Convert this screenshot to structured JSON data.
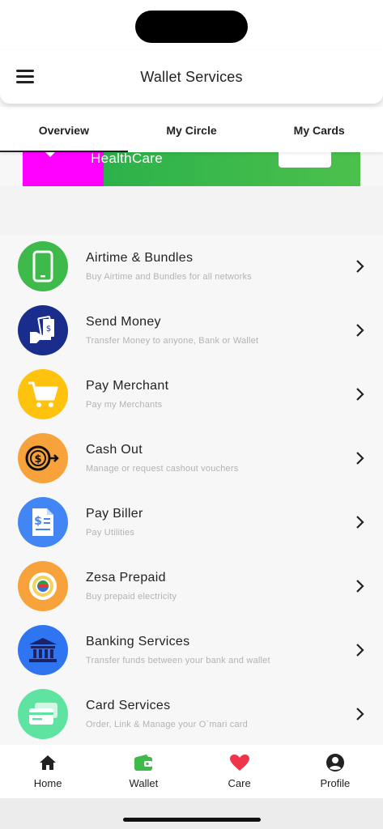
{
  "header": {
    "title": "Wallet Services"
  },
  "tabs": [
    {
      "label": "Overview",
      "active": true
    },
    {
      "label": "My Circle",
      "active": false
    },
    {
      "label": "My Cards",
      "active": false
    }
  ],
  "banner": {
    "text": "HealthCare",
    "colors": {
      "left": "#ff00ff",
      "right": "#3cb84a"
    }
  },
  "services": [
    {
      "title": "Airtime & Bundles",
      "subtitle": "Buy Airtime and Bundles for all networks",
      "icon": "phone-icon",
      "color": "#3dba4a"
    },
    {
      "title": "Send Money",
      "subtitle": "Transfer Money to anyone, Bank or Wallet",
      "icon": "money-hand-icon",
      "color": "#1a2d8c"
    },
    {
      "title": "Pay Merchant",
      "subtitle": "Pay my Merchants",
      "icon": "shopping-cart-icon",
      "color": "#ffc20e"
    },
    {
      "title": "Cash Out",
      "subtitle": "Manage or request cashout vouchers",
      "icon": "dollar-arrow-icon",
      "color": "#f7a23b"
    },
    {
      "title": "Pay Biller",
      "subtitle": "Pay Utilities",
      "icon": "invoice-icon",
      "color": "#4286f5"
    },
    {
      "title": "Zesa Prepaid",
      "subtitle": "Buy prepaid electricity",
      "icon": "zesa-logo-icon",
      "color": "#f7a23b"
    },
    {
      "title": "Banking Services",
      "subtitle": "Transfer funds between your bank and wallet",
      "icon": "bank-icon",
      "color": "#2f74f0"
    },
    {
      "title": "Card Services",
      "subtitle": "Order, Link & Manage your O`mari card",
      "icon": "cards-icon",
      "color": "#5ee3a1"
    }
  ],
  "bottom_nav": [
    {
      "label": "Home",
      "icon": "home-icon"
    },
    {
      "label": "Wallet",
      "icon": "wallet-icon",
      "active": true,
      "color": "#3dba4a"
    },
    {
      "label": "Care",
      "icon": "heart-icon",
      "color": "#f0344a"
    },
    {
      "label": "Profile",
      "icon": "profile-icon"
    }
  ]
}
